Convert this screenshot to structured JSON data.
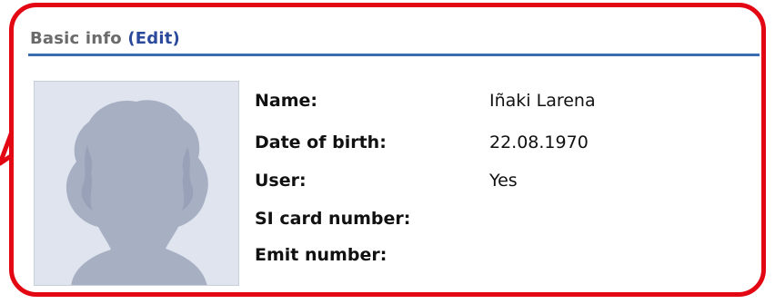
{
  "section": {
    "title": "Basic info",
    "edit_label": "(Edit)"
  },
  "profile": {
    "photo_icon": "silhouette-placeholder-icon",
    "fields": [
      {
        "label": "Name:",
        "value": "Iñaki Larena"
      },
      {
        "label": "Date of birth:",
        "value": "22.08.1970"
      },
      {
        "label": "User:",
        "value": "Yes"
      },
      {
        "label": "SI card number:",
        "value": ""
      },
      {
        "label": "Emit number:",
        "value": ""
      }
    ]
  },
  "colors": {
    "callout_border": "#e30613",
    "header_rule": "#3b6db3",
    "edit_link": "#2b4a9b",
    "title_text": "#6b6b6b"
  }
}
